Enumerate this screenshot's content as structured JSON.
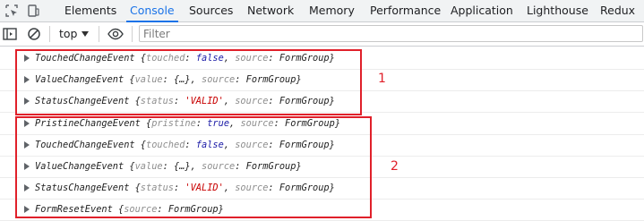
{
  "tabs": [
    "Elements",
    "Console",
    "Sources",
    "Network",
    "Memory",
    "Performance",
    "Application",
    "Lighthouse",
    "Redux"
  ],
  "active_tab": "Console",
  "toolbar": {
    "context": "top",
    "filter_placeholder": "Filter"
  },
  "icons": {
    "inspect": "inspect-element-icon",
    "device": "device-toolbar-icon",
    "sidebar": "sidebar-toggle-icon",
    "clear": "clear-console-icon",
    "eye": "live-expression-icon",
    "expand": "expand-arrow-icon"
  },
  "colors": {
    "accent": "#1a73e8",
    "annotation": "#e0202a",
    "property_key": "#8e8e8e",
    "keyword": "#1a1aa6",
    "string": "#c80000"
  },
  "logs": [
    {
      "event": "TouchedChangeEvent",
      "k1": "touched",
      "v1": "false",
      "source": "FormGroup"
    },
    {
      "event": "ValueChangeEvent",
      "k1": "value",
      "v1": "{…}",
      "source": "FormGroup"
    },
    {
      "event": "StatusChangeEvent",
      "k1": "status",
      "v1": "'VALID'",
      "source": "FormGroup"
    },
    {
      "event": "PristineChangeEvent",
      "k1": "pristine",
      "v1": "true",
      "source": "FormGroup"
    },
    {
      "event": "TouchedChangeEvent",
      "k1": "touched",
      "v1": "false",
      "source": "FormGroup"
    },
    {
      "event": "ValueChangeEvent",
      "k1": "value",
      "v1": "{…}",
      "source": "FormGroup"
    },
    {
      "event": "StatusChangeEvent",
      "k1": "status",
      "v1": "'VALID'",
      "source": "FormGroup"
    },
    {
      "event": "FormResetEvent",
      "source": "FormGroup"
    }
  ],
  "source_key": "source",
  "annotations": [
    "1",
    "2"
  ]
}
